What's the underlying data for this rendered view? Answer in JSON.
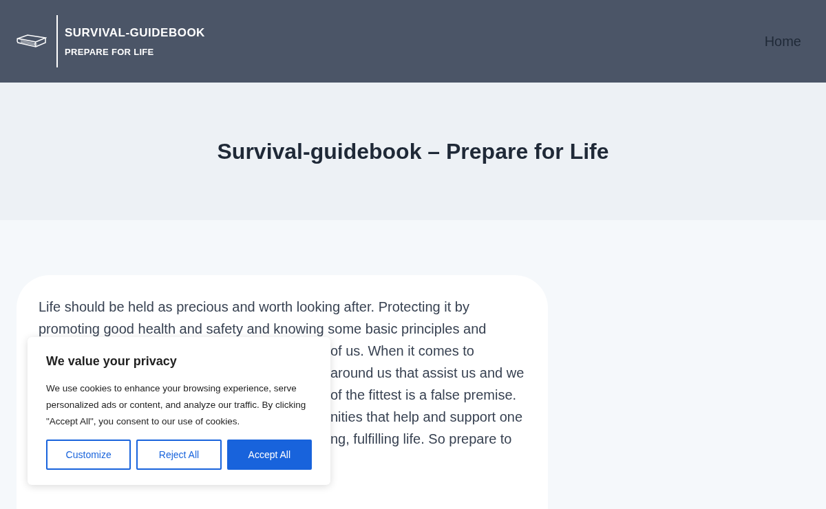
{
  "header": {
    "logo_title": "SURVIVAL-GUIDEBOOK",
    "logo_tagline": "PREPARE FOR LIFE",
    "nav": [
      {
        "label": "Home"
      }
    ]
  },
  "hero": {
    "title": "Survival-guidebook – Prepare for Life"
  },
  "article": {
    "lines": [
      "Life should be held as precious and worth looking after. Protecting it by",
      "promoting good health and safety and knowing some basic principles and"
    ],
    "partly_covered_lines": [
      "of us. When it comes to",
      "around us that assist us and we",
      "of the fittest is a false premise.",
      "nities that help and support one",
      "ng, fulfilling life. So prepare to"
    ]
  },
  "cookie_banner": {
    "title": "We value your privacy",
    "message": "We use cookies to enhance your browsing experience, serve personalized ads or content, and analyze our traffic. By clicking \"Accept All\", you consent to our use of cookies.",
    "buttons": [
      {
        "label": "Customize",
        "kind": "outline"
      },
      {
        "label": "Reject All",
        "kind": "outline"
      },
      {
        "label": "Accept All",
        "kind": "primary"
      }
    ]
  }
}
